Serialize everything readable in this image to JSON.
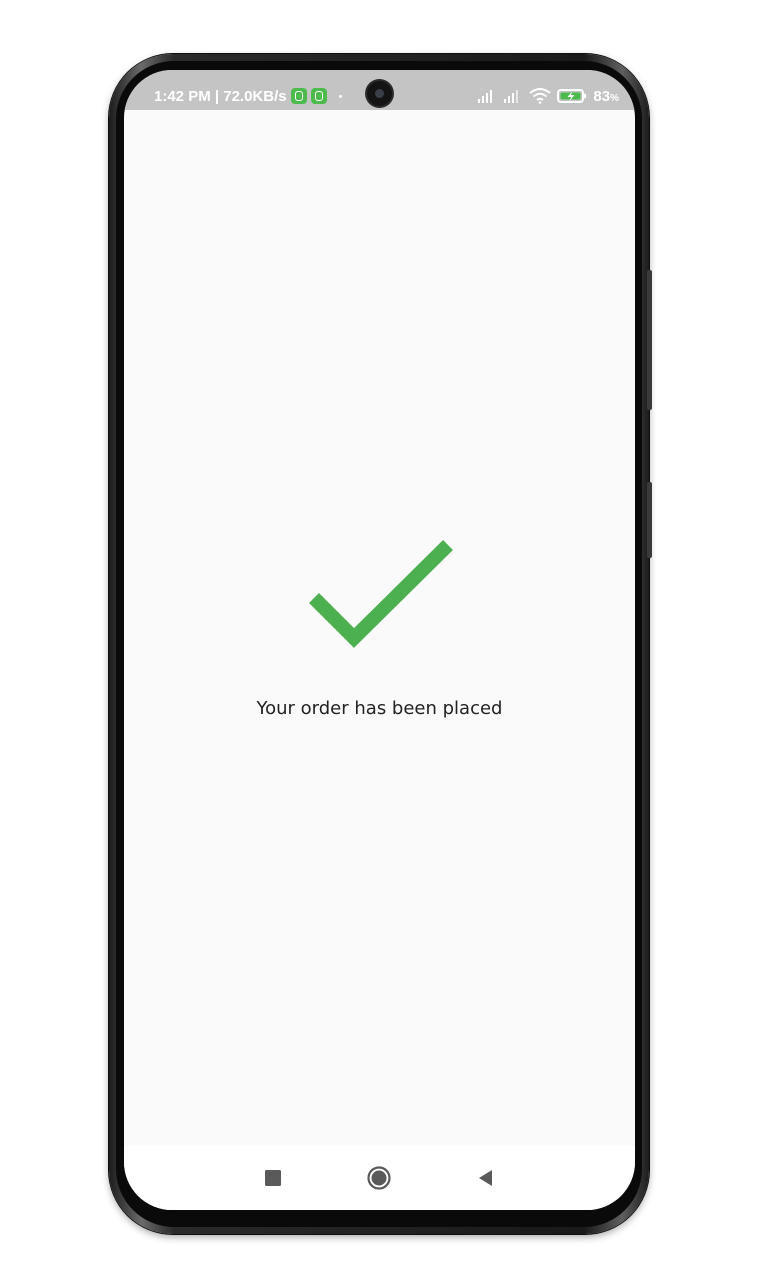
{
  "status_bar": {
    "time_speed": "1:42 PM | 72.0KB/s",
    "battery_percent": "83",
    "battery_unit": "%",
    "icons": [
      "app-notification-icon",
      "app-notification-icon",
      "signal-icon",
      "signal-icon",
      "wifi-icon",
      "battery-charging-icon"
    ]
  },
  "main": {
    "success_icon": "checkmark-icon",
    "message": "Your order has been placed"
  },
  "nav_bar": {
    "buttons": [
      "recents-button",
      "home-button",
      "back-button"
    ]
  },
  "colors": {
    "checkmark": "#4caf50",
    "status_bar_bg": "#c4c4c4",
    "screen_bg": "#fafafa"
  }
}
